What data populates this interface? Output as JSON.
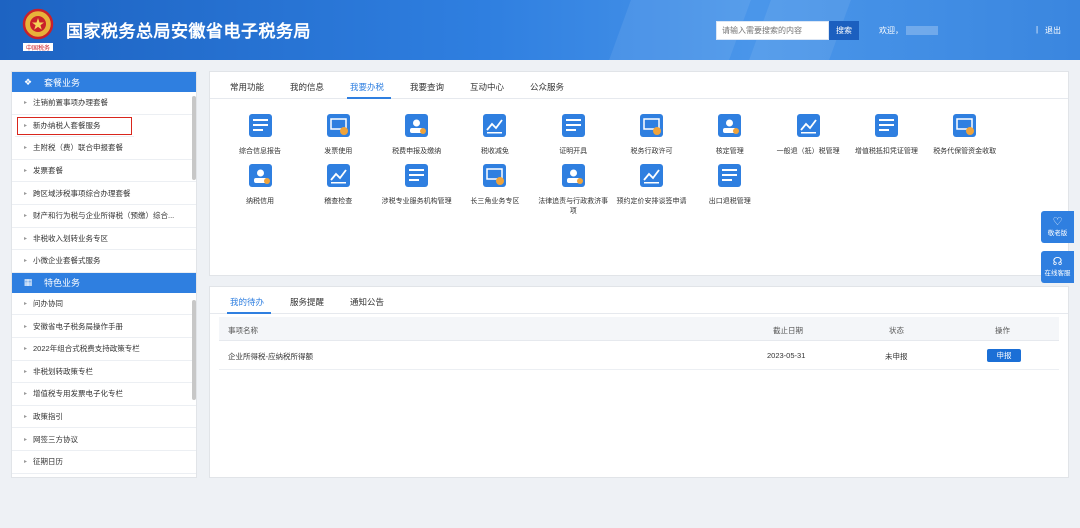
{
  "header": {
    "title": "国家税务总局安徽省电子税务局",
    "search_placeholder": "请输入需要搜索的内容",
    "search_label": "搜索",
    "welcome": "欢迎，",
    "separator": "|",
    "logout": "退出",
    "emblem_text": "中国税务"
  },
  "sidebar": {
    "section1": "套餐业务",
    "items1": [
      "注销前置事项办理套餐",
      "新办纳税人套餐服务",
      "主附税（费）联合申报套餐",
      "发票套餐",
      "跨区域涉税事项综合办理套餐",
      "财产和行为税与企业所得税（预缴）综合...",
      "非税收入划转业务专区",
      "小微企业套餐式服务"
    ],
    "section2": "特色业务",
    "items2": [
      "问办协同",
      "安徽省电子税务局操作手册",
      "2022年组合式税费支持政策专栏",
      "非税划转政策专栏",
      "增值税专用发票电子化专栏",
      "政策指引",
      "网签三方协议",
      "征期日历"
    ]
  },
  "top_tabs": [
    "常用功能",
    "我的信息",
    "我要办税",
    "我要查询",
    "互动中心",
    "公众服务"
  ],
  "services_row1": [
    {
      "label": "综合信息报告",
      "icon": "report-icon"
    },
    {
      "label": "发票使用",
      "icon": "invoice-icon"
    },
    {
      "label": "税费申报及缴纳",
      "icon": "tax-declare-icon"
    },
    {
      "label": "税收减免",
      "icon": "tax-relief-icon"
    },
    {
      "label": "证明开具",
      "icon": "certificate-icon"
    },
    {
      "label": "税务行政许可",
      "icon": "license-icon"
    },
    {
      "label": "核定管理",
      "icon": "assessment-icon"
    },
    {
      "label": "一般退（抵）税管理",
      "icon": "refund-icon"
    },
    {
      "label": "增值税抵扣凭证管理",
      "icon": "vat-deduction-icon"
    },
    {
      "label": "税务代保管资金收取",
      "icon": "custody-icon"
    }
  ],
  "services_row2": [
    {
      "label": "纳税信用",
      "icon": "credit-icon"
    },
    {
      "label": "稽查检查",
      "icon": "inspection-icon"
    },
    {
      "label": "涉税专业服务机构管理",
      "icon": "agency-icon"
    },
    {
      "label": "长三角业务专区",
      "icon": "yrd-icon"
    },
    {
      "label": "法律追责与行政救济事项",
      "icon": "legal-icon"
    },
    {
      "label": "预约定价安排谈签申请",
      "icon": "pricing-icon"
    },
    {
      "label": "出口退税管理",
      "icon": "export-refund-icon"
    }
  ],
  "bottom_tabs": [
    "我的待办",
    "服务提醒",
    "通知公告"
  ],
  "todo_table": {
    "headers": [
      "事项名称",
      "截止日期",
      "状态",
      "操作"
    ],
    "rows": [
      {
        "name": "企业所得税-应纳税所得额",
        "deadline": "2023-05-31",
        "status": "未申报",
        "action": "申报"
      }
    ]
  },
  "floating": [
    {
      "label": "敬老版",
      "icon": "elder-mode-icon"
    },
    {
      "label": "在线客服",
      "icon": "headset-icon"
    }
  ],
  "colors": {
    "primary": "#2f7fe0",
    "header_dark": "#1d63c2",
    "highlight_border": "#d9261c",
    "icon_accent": "#f0a33a"
  }
}
